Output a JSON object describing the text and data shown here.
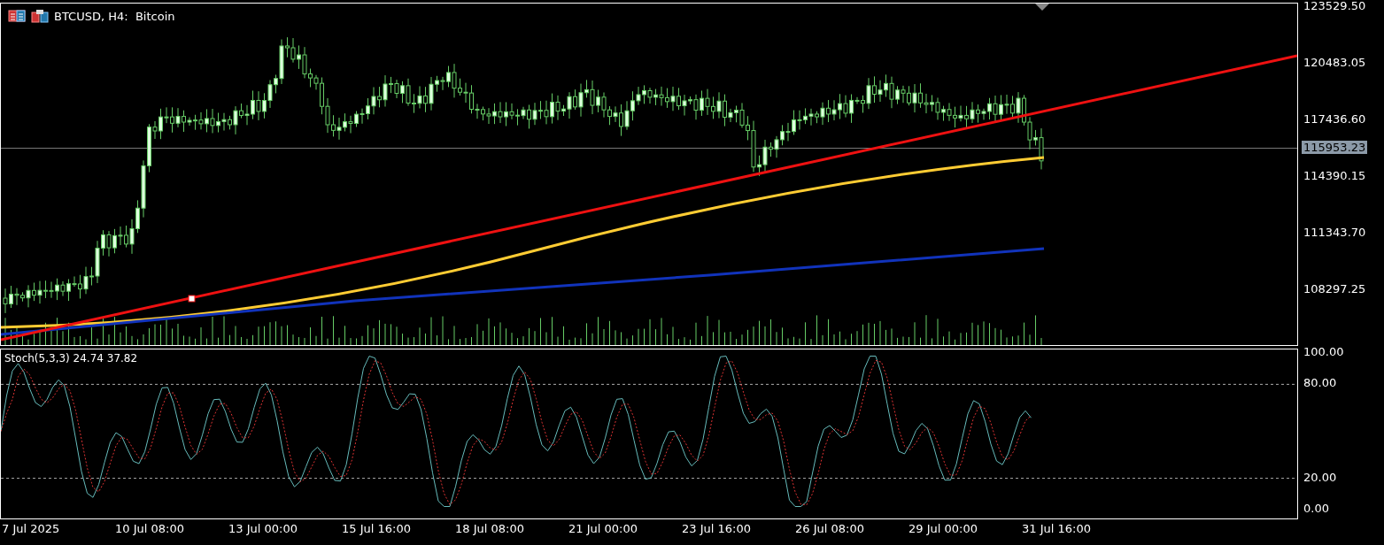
{
  "chart_title": "BTCUSD, H4:  Bitcoin",
  "price_axis": [
    "123529.50",
    "120483.05",
    "117436.60",
    "114390.15",
    "111343.70",
    "108297.25"
  ],
  "current_price": "115953.23",
  "indicator": {
    "label": "Stoch(5,3,3) 24.74 37.82",
    "axis": [
      {
        "label": "100.00",
        "kind": "edge"
      },
      {
        "label": "80.00",
        "kind": "level"
      },
      {
        "label": "20.00",
        "kind": "level"
      },
      {
        "label": "0.00",
        "kind": "edge"
      }
    ]
  },
  "time_axis": [
    "7 Jul 2025",
    "10 Jul 08:00",
    "13 Jul 00:00",
    "15 Jul 16:00",
    "18 Jul 08:00",
    "21 Jul 00:00",
    "23 Jul 16:00",
    "26 Jul 08:00",
    "29 Jul 00:00",
    "31 Jul 16:00"
  ]
}
